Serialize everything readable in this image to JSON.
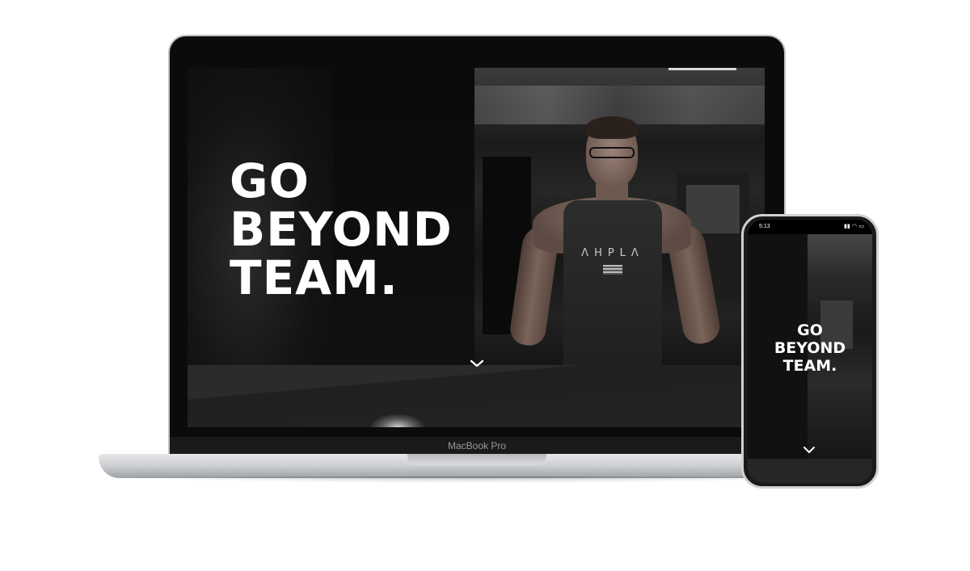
{
  "hero": {
    "title_lines": [
      "GO",
      "BEYOND",
      "TEAM."
    ]
  },
  "athlete": {
    "shirt_text": "ΛHPLΛ"
  },
  "laptop": {
    "brand_label": "MacBook Pro"
  },
  "phone": {
    "status_time": "5:13",
    "status_icons": "▮▮ ◠ ▭",
    "title_lines": [
      "GO",
      "BEYOND",
      "TEAM."
    ]
  },
  "icons": {
    "desktop_scroll": "chevron-down-icon",
    "mobile_scroll": "chevron-down-icon"
  },
  "colors": {
    "background": "#ffffff",
    "screen": "#0e0e0e",
    "text": "#ffffff",
    "aluminum": "#cfd1d4"
  }
}
